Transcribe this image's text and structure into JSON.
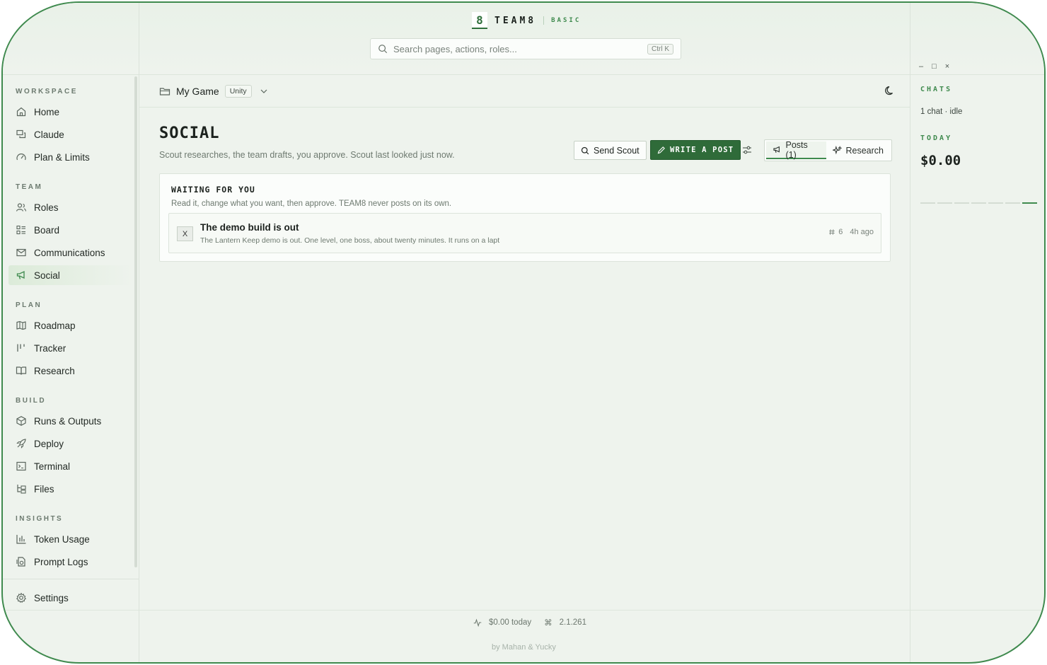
{
  "brand": {
    "logo": "8",
    "name": "TEAM8",
    "tier": "BASIC"
  },
  "search": {
    "placeholder": "Search pages, actions, roles...",
    "shortcut": "Ctrl K"
  },
  "sidebar": {
    "sections": [
      {
        "title": "WORKSPACE",
        "items": [
          {
            "label": "Home",
            "icon": "home-icon"
          },
          {
            "label": "Claude",
            "icon": "chat-icon"
          },
          {
            "label": "Plan & Limits",
            "icon": "gauge-icon"
          }
        ]
      },
      {
        "title": "TEAM",
        "items": [
          {
            "label": "Roles",
            "icon": "users-icon"
          },
          {
            "label": "Board",
            "icon": "board-icon"
          },
          {
            "label": "Communications",
            "icon": "mail-icon"
          },
          {
            "label": "Social",
            "icon": "megaphone-icon",
            "active": true
          }
        ]
      },
      {
        "title": "PLAN",
        "items": [
          {
            "label": "Roadmap",
            "icon": "map-icon"
          },
          {
            "label": "Tracker",
            "icon": "tracker-icon"
          },
          {
            "label": "Research",
            "icon": "book-icon"
          }
        ]
      },
      {
        "title": "BUILD",
        "items": [
          {
            "label": "Runs & Outputs",
            "icon": "package-icon"
          },
          {
            "label": "Deploy",
            "icon": "rocket-icon"
          },
          {
            "label": "Terminal",
            "icon": "terminal-icon"
          },
          {
            "label": "Files",
            "icon": "folder-tree-icon"
          }
        ]
      },
      {
        "title": "INSIGHTS",
        "items": [
          {
            "label": "Token Usage",
            "icon": "bar-chart-icon"
          },
          {
            "label": "Prompt Logs",
            "icon": "logs-icon"
          }
        ]
      }
    ],
    "settings": "Settings"
  },
  "project": {
    "name": "My Game",
    "engine": "Unity"
  },
  "page": {
    "title": "SOCIAL",
    "subtitle": "Scout researches, the team drafts, you approve. Scout last looked just now.",
    "send_scout": "Send Scout",
    "write_post": "WRITE A POST",
    "tabs": [
      {
        "label": "Posts (1)",
        "active": true
      },
      {
        "label": "Research",
        "active": false
      }
    ]
  },
  "waiting": {
    "title": "WAITING FOR YOU",
    "subtitle": "Read it, change what you want, then approve. TEAM8 never posts on its own.",
    "posts": [
      {
        "badge": "X",
        "title": "The demo build is out",
        "body": "The Lantern Keep demo is out. One level, one boss, about twenty minutes. It runs on a lapt",
        "tags": "6",
        "time": "4h ago"
      }
    ]
  },
  "footer": {
    "cost": "$0.00 today",
    "version": "2.1.261",
    "credit": "by Mahan & Yucky"
  },
  "right_panel": {
    "window_controls": {
      "minimize": "–",
      "maximize": "□",
      "close": "×"
    },
    "chats_label": "CHATS",
    "chats_status": "1 chat · idle",
    "today_label": "TODAY",
    "today_cost": "$0.00",
    "spark_active_index": 6,
    "spark_count": 7
  },
  "colors": {
    "accent": "#3f8a4e",
    "primary_button": "#2f6b39",
    "background": "#eef3ed"
  }
}
